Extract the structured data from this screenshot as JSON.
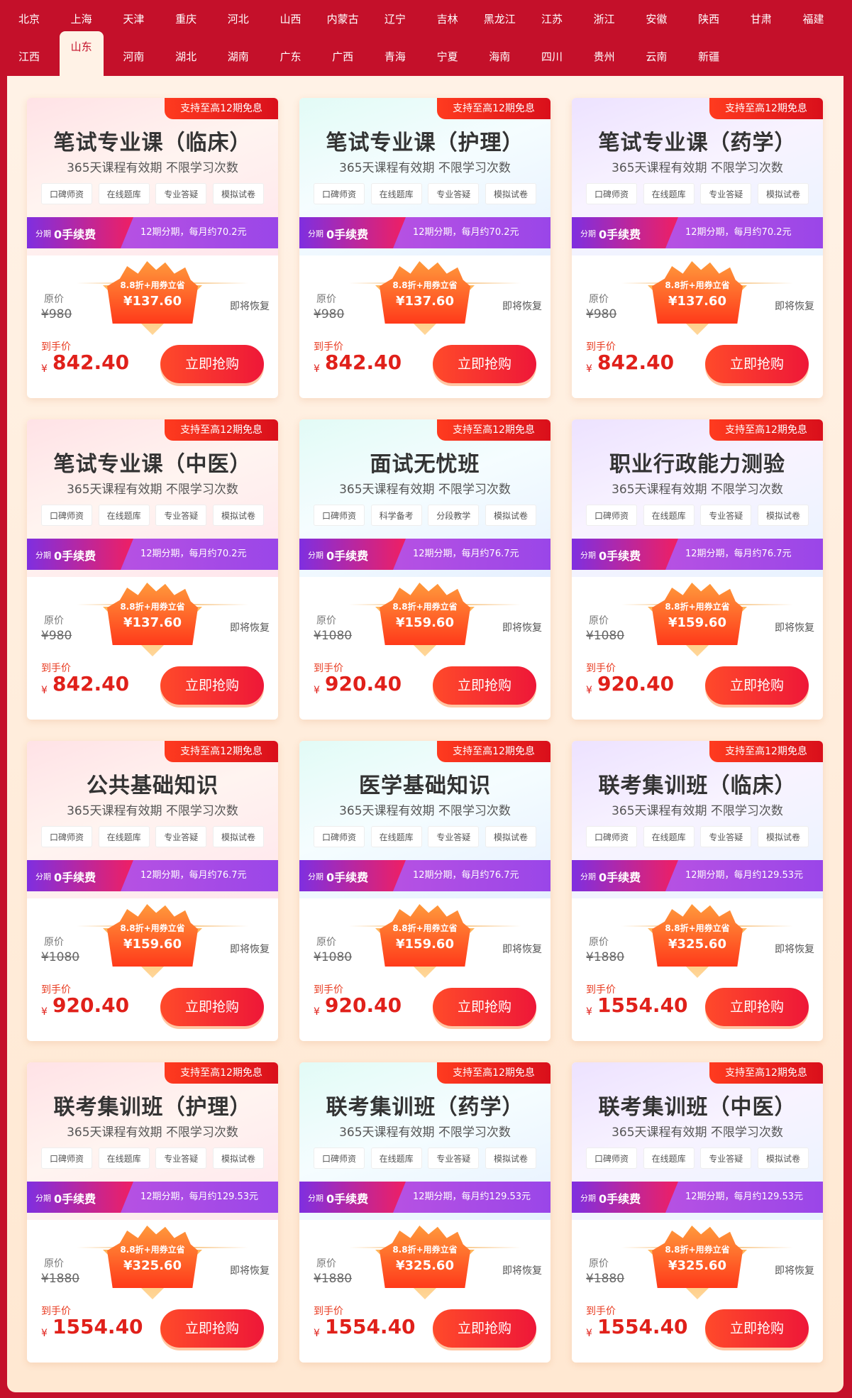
{
  "provinces": [
    "北京",
    "上海",
    "天津",
    "重庆",
    "河北",
    "山西",
    "内蒙古",
    "辽宁",
    "吉林",
    "黑龙江",
    "江苏",
    "浙江",
    "安徽",
    "陕西",
    "甘肃",
    "福建",
    "江西",
    "山东",
    "河南",
    "湖北",
    "湖南",
    "广东",
    "广西",
    "青海",
    "宁夏",
    "海南",
    "四川",
    "贵州",
    "云南",
    "新疆"
  ],
  "active_province": "山东",
  "labels": {
    "badge": "支持至高12期免息",
    "validity": "365天课程有效期 不限学习次数",
    "fee_prefix": "分期",
    "fee_main": "0手续费",
    "orig_label": "原价",
    "discount": "8.8折+用券立省",
    "restore": "即将恢复",
    "final_label": "到手价",
    "currency": "¥",
    "buy": "立即抢购"
  },
  "cards": [
    {
      "title": "笔试专业课（临床）",
      "theme": "pink",
      "chips": [
        "口碑师资",
        "在线题库",
        "专业答疑",
        "模拟试卷"
      ],
      "plan": "12期分期，每月约70.2元",
      "orig": "¥980",
      "sale": "¥137.60",
      "final": "842.40"
    },
    {
      "title": "笔试专业课（护理）",
      "theme": "cyan",
      "chips": [
        "口碑师资",
        "在线题库",
        "专业答疑",
        "模拟试卷"
      ],
      "plan": "12期分期，每月约70.2元",
      "orig": "¥980",
      "sale": "¥137.60",
      "final": "842.40"
    },
    {
      "title": "笔试专业课（药学）",
      "theme": "purple",
      "chips": [
        "口碑师资",
        "在线题库",
        "专业答疑",
        "模拟试卷"
      ],
      "plan": "12期分期，每月约70.2元",
      "orig": "¥980",
      "sale": "¥137.60",
      "final": "842.40"
    },
    {
      "title": "笔试专业课（中医）",
      "theme": "pink",
      "chips": [
        "口碑师资",
        "在线题库",
        "专业答疑",
        "模拟试卷"
      ],
      "plan": "12期分期，每月约70.2元",
      "orig": "¥980",
      "sale": "¥137.60",
      "final": "842.40"
    },
    {
      "title": "面试无忧班",
      "theme": "cyan",
      "chips": [
        "口碑师资",
        "科学备考",
        "分段教学",
        "模拟试卷"
      ],
      "plan": "12期分期，每月约76.7元",
      "orig": "¥1080",
      "sale": "¥159.60",
      "final": "920.40"
    },
    {
      "title": "职业行政能力测验",
      "theme": "purple",
      "chips": [
        "口碑师资",
        "在线题库",
        "专业答疑",
        "模拟试卷"
      ],
      "plan": "12期分期，每月约76.7元",
      "orig": "¥1080",
      "sale": "¥159.60",
      "final": "920.40"
    },
    {
      "title": "公共基础知识",
      "theme": "pink",
      "chips": [
        "口碑师资",
        "在线题库",
        "专业答疑",
        "模拟试卷"
      ],
      "plan": "12期分期，每月约76.7元",
      "orig": "¥1080",
      "sale": "¥159.60",
      "final": "920.40"
    },
    {
      "title": "医学基础知识",
      "theme": "cyan",
      "chips": [
        "口碑师资",
        "在线题库",
        "专业答疑",
        "模拟试卷"
      ],
      "plan": "12期分期，每月约76.7元",
      "orig": "¥1080",
      "sale": "¥159.60",
      "final": "920.40"
    },
    {
      "title": "联考集训班（临床）",
      "theme": "purple",
      "chips": [
        "口碑师资",
        "在线题库",
        "专业答疑",
        "模拟试卷"
      ],
      "plan": "12期分期，每月约129.53元",
      "orig": "¥1880",
      "sale": "¥325.60",
      "final": "1554.40"
    },
    {
      "title": "联考集训班（护理）",
      "theme": "pink",
      "chips": [
        "口碑师资",
        "在线题库",
        "专业答疑",
        "模拟试卷"
      ],
      "plan": "12期分期，每月约129.53元",
      "orig": "¥1880",
      "sale": "¥325.60",
      "final": "1554.40"
    },
    {
      "title": "联考集训班（药学）",
      "theme": "cyan",
      "chips": [
        "口碑师资",
        "在线题库",
        "专业答疑",
        "模拟试卷"
      ],
      "plan": "12期分期，每月约129.53元",
      "orig": "¥1880",
      "sale": "¥325.60",
      "final": "1554.40"
    },
    {
      "title": "联考集训班（中医）",
      "theme": "purple",
      "chips": [
        "口碑师资",
        "在线题库",
        "专业答疑",
        "模拟试卷"
      ],
      "plan": "12期分期，每月约129.53元",
      "orig": "¥1880",
      "sale": "¥325.60",
      "final": "1554.40"
    }
  ]
}
